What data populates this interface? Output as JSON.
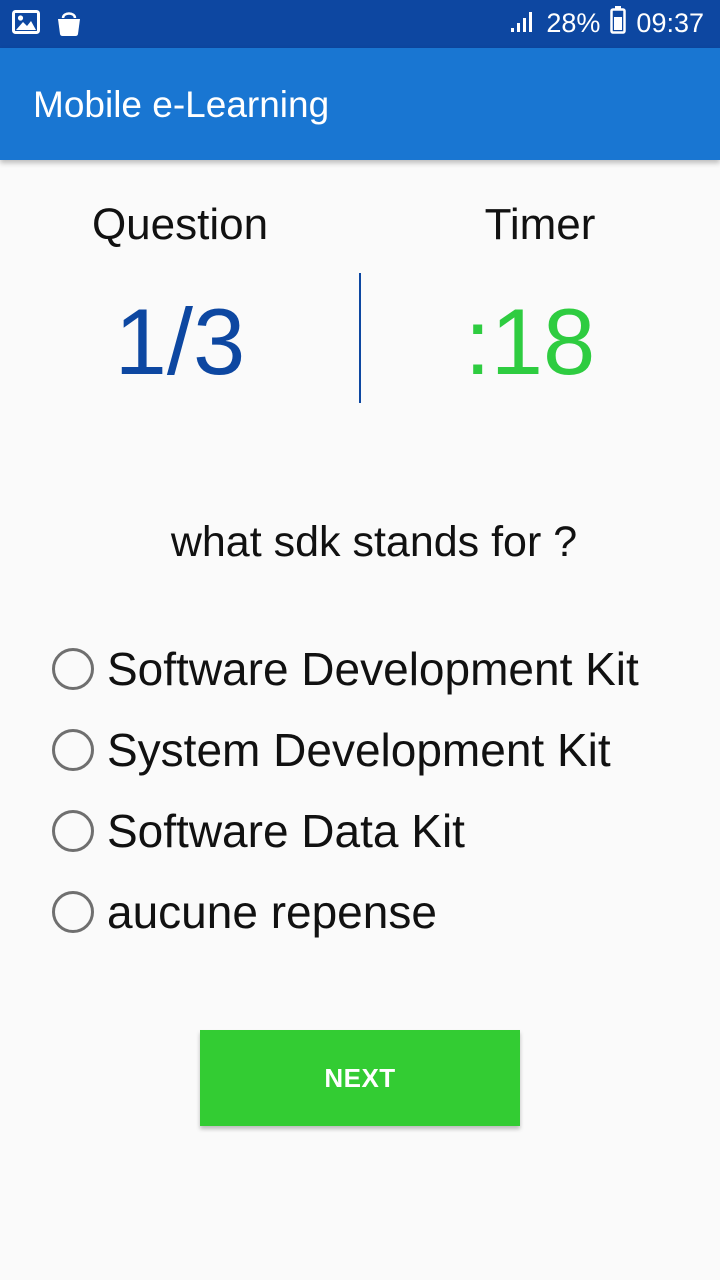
{
  "status_bar": {
    "left_icons": [
      "image-icon",
      "shopping-bag-icon"
    ],
    "signal_icon": "signal-icon",
    "battery_percent": "28%",
    "battery_icon": "battery-icon",
    "time": "09:37"
  },
  "app_bar": {
    "title": "Mobile e-Learning"
  },
  "stats": {
    "question_label": "Question",
    "question_value": "1/3",
    "timer_label": "Timer",
    "timer_value": ":18"
  },
  "question": {
    "text": "what sdk stands for ?"
  },
  "options": [
    {
      "label": "Software Development Kit",
      "selected": false
    },
    {
      "label": "System Development Kit",
      "selected": false
    },
    {
      "label": "Software Data Kit",
      "selected": false
    },
    {
      "label": "aucune repense",
      "selected": false
    }
  ],
  "next_button": {
    "label": "NEXT"
  },
  "colors": {
    "status_bar": "#0d47a1",
    "app_bar": "#1976d2",
    "question_counter": "#0d47a1",
    "timer": "#2ecc40",
    "next_button": "#33cc33"
  }
}
